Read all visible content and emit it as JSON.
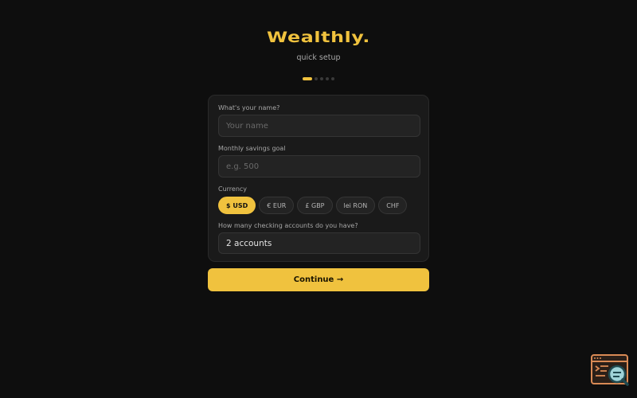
{
  "brand": {
    "logo": "Wealthly.",
    "subtitle": "quick setup",
    "accent": "#f0c23e"
  },
  "progress": {
    "total_steps": 5,
    "current_step": 1
  },
  "form": {
    "name": {
      "label": "What's your name?",
      "placeholder": "Your name",
      "value": ""
    },
    "savings": {
      "label": "Monthly savings goal",
      "placeholder": "e.g. 500",
      "value": ""
    },
    "currency": {
      "label": "Currency",
      "selected": "USD",
      "options": [
        {
          "code": "USD",
          "label": "$ USD"
        },
        {
          "code": "EUR",
          "label": "€ EUR"
        },
        {
          "code": "GBP",
          "label": "£ GBP"
        },
        {
          "code": "RON",
          "label": "lei RON"
        },
        {
          "code": "CHF",
          "label": "CHF"
        }
      ]
    },
    "accounts": {
      "label": "How many checking accounts do you have?",
      "value": "2 accounts"
    }
  },
  "actions": {
    "continue_label": "Continue →"
  },
  "widget": {
    "icon": "browser-search-icon"
  }
}
